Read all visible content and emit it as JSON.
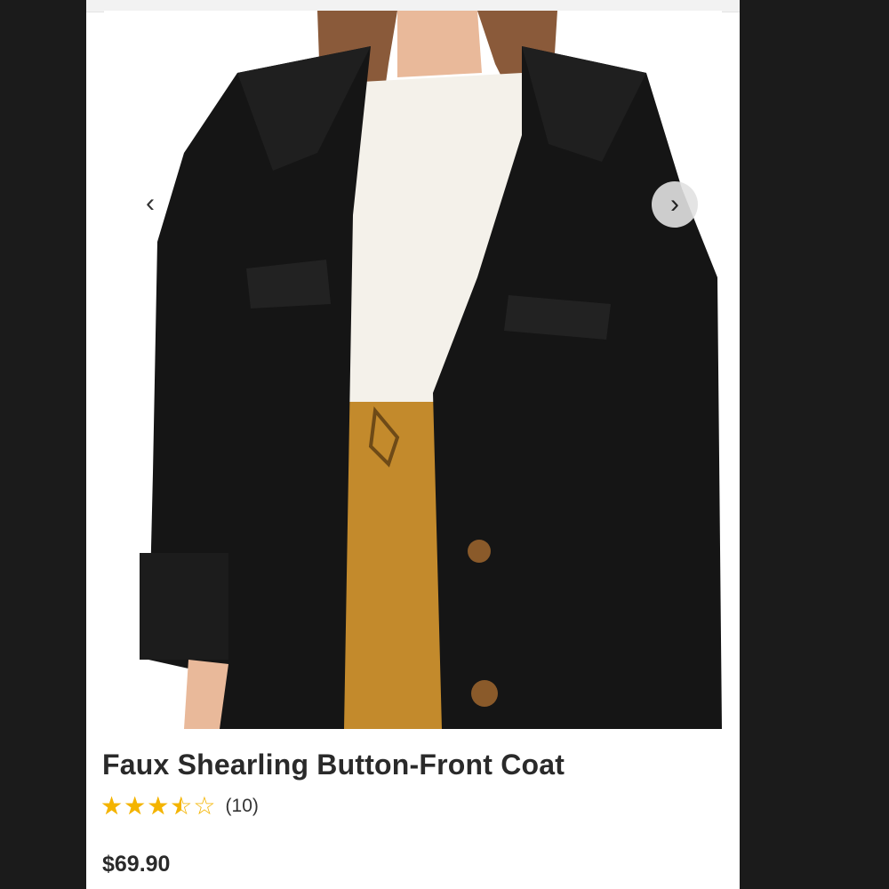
{
  "product": {
    "title": "Faux Shearling Button-Front Coat",
    "rating_value": 3.5,
    "rating_max": 5,
    "rating_count_label": "(10)",
    "price": "$69.90"
  },
  "gallery": {
    "prev_icon_glyph": "‹",
    "next_icon_glyph": "›"
  },
  "colors": {
    "star": "#f4b400",
    "coat": "#151515",
    "sweater": "#f4f1ea",
    "pants": "#c38a2c"
  },
  "icons": [
    "chevron-left-icon",
    "chevron-right-icon",
    "star-icon"
  ]
}
